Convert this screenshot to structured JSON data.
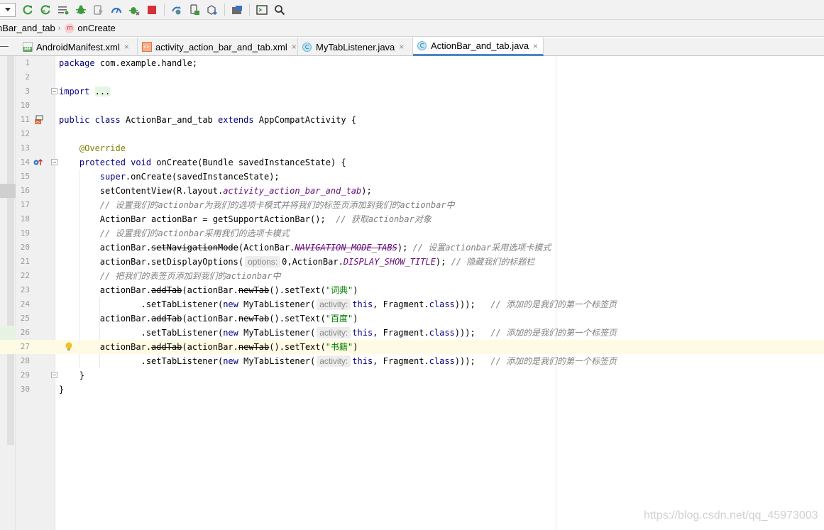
{
  "toolbar": {
    "icons": [
      "run-sync-icon",
      "rerun-icon",
      "coverage-list-icon",
      "debug-icon",
      "profile-icon",
      "gauge-icon",
      "attach-debugger-icon",
      "stop-icon",
      "sync-gradle-icon",
      "device-file-icon",
      "sdk-download-icon",
      "structure-icon",
      "terminal-icon",
      "search-icon"
    ],
    "colors": {
      "green": "#3d9a40",
      "red": "#d6303a",
      "gray": "#6b6b6b",
      "blue": "#3574c4"
    }
  },
  "breadcrumb": {
    "class_name": "nBar_and_tab",
    "method_badge": "m",
    "method_name": "onCreate"
  },
  "tabs": [
    {
      "label": "AndroidManifest.xml",
      "icon": "manifest-file-icon",
      "badge": "MF",
      "active": false
    },
    {
      "label": "activity_action_bar_and_tab.xml",
      "icon": "xml-layout-file-icon",
      "badge": "<>",
      "active": false
    },
    {
      "label": "MyTabListener.java",
      "icon": "java-class-icon",
      "badge": "C",
      "active": false
    },
    {
      "label": "ActionBar_and_tab.java",
      "icon": "java-class-icon",
      "badge": "C",
      "active": true
    }
  ],
  "tab_close": "×",
  "code": {
    "line_numbers": [
      "1",
      "2",
      "3",
      "10",
      "11",
      "12",
      "13",
      "14",
      "15",
      "16",
      "17",
      "18",
      "19",
      "20",
      "21",
      "22",
      "23",
      "24",
      "25",
      "26",
      "27",
      "28",
      "29",
      "30"
    ],
    "l1_kw": "package",
    "l1_rest": " com.example.handle;",
    "l3_kw": "import",
    "l3_fold": "...",
    "l11_kw1": "public",
    "l11_kw2": "class",
    "l11_name": " ActionBar_and_tab ",
    "l11_kw3": "extends",
    "l11_rest": " AppCompatActivity {",
    "l13_ann": "@Override",
    "l14_kw1": "protected",
    "l14_kw2": "void",
    "l14_rest": " onCreate(Bundle savedInstanceState) {",
    "l15_kw": "super",
    "l15_rest": ".onCreate(savedInstanceState);",
    "l16_a": "setContentView(R.layout.",
    "l16_field": "activity_action_bar_and_tab",
    "l16_b": ");",
    "l17_cmt": "// 设置我们的actionbar为我们的选项卡模式并将我们的标签页添加到我们的actionbar中",
    "l18_code": "ActionBar actionBar = getSupportActionBar();  ",
    "l18_cmt": "// 获取actionbar对象",
    "l19_cmt": "// 设置我们的actionbar采用我们的选项卡模式",
    "l20_a": "actionBar.",
    "l20_strike": "setNavigationMode",
    "l20_b": "(ActionBar.",
    "l20_field": "NAVIGATION_MODE_TABS",
    "l20_c": "); ",
    "l20_cmt": "// 设置actionbar采用选项卡模式",
    "l21_a": "actionBar.setDisplayOptions(",
    "l21_hint": "options:",
    "l21_b": "0,ActionBar.",
    "l21_field": "DISPLAY_SHOW_TITLE",
    "l21_c": "); ",
    "l21_cmt": "// 隐藏我们的标题栏",
    "l22_cmt": "// 把我们的表签页添加到我们的actionbar中",
    "add_a": "actionBar.",
    "add_strike1": "addTab",
    "add_b": "(actionBar.",
    "add_strike2": "newTab",
    "add_c": "().setText(",
    "tab_text_1": "\"词典\"",
    "tab_text_2": "\"百度\"",
    "tab_text_3": "\"书籍\"",
    "close_paren": ")",
    "listener_a": ".setTabListener(",
    "listener_kw_new": "new",
    "listener_b": " MyTabListener(",
    "listener_hint": "activity:",
    "listener_kw_this": "this",
    "listener_c": ", Fragment.",
    "listener_kw_class": "class",
    "listener_d": ")));   ",
    "listener_cmt": "// 添加的是我们的第一个标签页",
    "l29": "}",
    "l30": "}"
  },
  "watermark": "https://blog.csdn.net/qq_45973003"
}
